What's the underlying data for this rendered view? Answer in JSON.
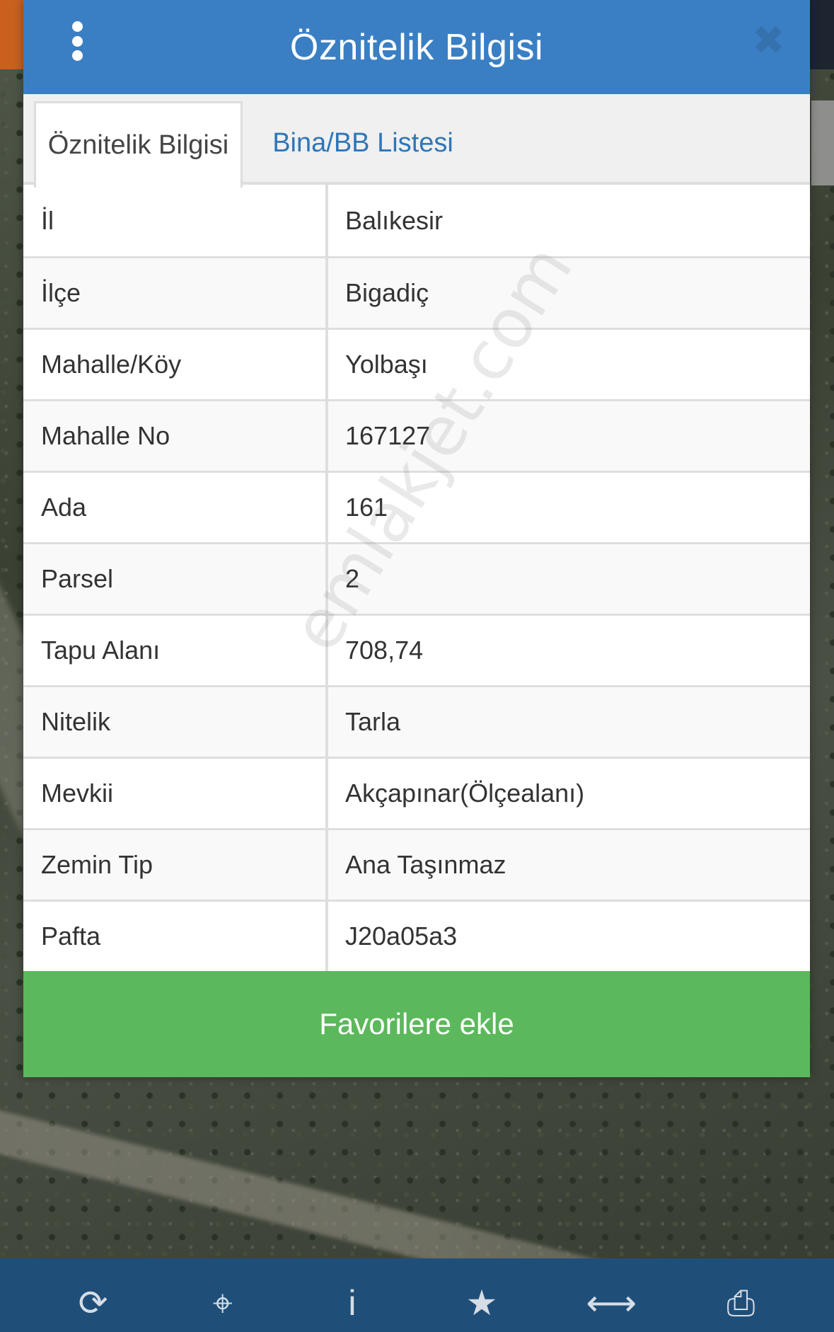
{
  "modal": {
    "title": "Öznitelik Bilgisi"
  },
  "tabs": [
    {
      "label": "Öznitelik Bilgisi",
      "active": true
    },
    {
      "label": "Bina/BB Listesi",
      "active": false
    }
  ],
  "attributes": [
    {
      "key": "İl",
      "value": "Balıkesir"
    },
    {
      "key": "İlçe",
      "value": "Bigadiç"
    },
    {
      "key": "Mahalle/Köy",
      "value": "Yolbaşı"
    },
    {
      "key": "Mahalle No",
      "value": "167127"
    },
    {
      "key": "Ada",
      "value": "161"
    },
    {
      "key": "Parsel",
      "value": "2"
    },
    {
      "key": "Tapu Alanı",
      "value": "708,74"
    },
    {
      "key": "Nitelik",
      "value": "Tarla"
    },
    {
      "key": "Mevkii",
      "value": "Akçapınar(Ölçealanı)"
    },
    {
      "key": "Zemin Tip",
      "value": "Ana Taşınmaz"
    },
    {
      "key": "Pafta",
      "value": "J20a05a3"
    }
  ],
  "favorite_button": {
    "label": "Favorilere ekle"
  },
  "watermark": "emlakjet.com",
  "toolbar": [
    {
      "icon": "refresh-icon",
      "glyph": "⟳"
    },
    {
      "icon": "crosshair-icon",
      "glyph": "⌖"
    },
    {
      "icon": "info-icon",
      "glyph": "i"
    },
    {
      "icon": "star-icon",
      "glyph": "★"
    },
    {
      "icon": "arrows-horizontal-icon",
      "glyph": "⟷"
    },
    {
      "icon": "print-icon",
      "glyph": "⎙"
    }
  ],
  "colors": {
    "header": "#3a7fc4",
    "favorite": "#5cb85c",
    "toolbar": "#1f4f79",
    "tab_active_text": "#444444",
    "tab_inactive_text": "#2f76b8"
  }
}
